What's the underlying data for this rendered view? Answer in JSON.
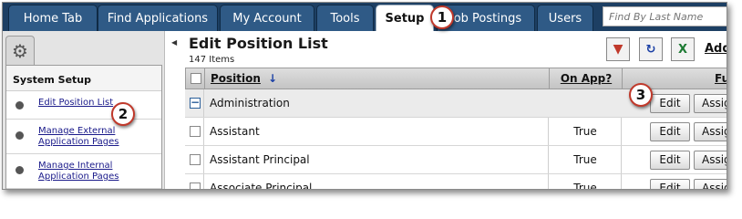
{
  "nav": {
    "tabs": [
      {
        "label": "Home Tab"
      },
      {
        "label": "Find Applications"
      },
      {
        "label": "My Account"
      },
      {
        "label": "Tools"
      },
      {
        "label": "Setup",
        "active": true
      },
      {
        "label": "Job Postings"
      },
      {
        "label": "Users"
      }
    ],
    "search_placeholder": "Find By Last Name"
  },
  "sidebar": {
    "title": "System Setup",
    "items": [
      {
        "label": "Edit Position List"
      },
      {
        "label": "Manage External Application Pages"
      },
      {
        "label": "Manage Internal Application Pages"
      }
    ],
    "icon": "gear-icon"
  },
  "main": {
    "title": "Edit Position List",
    "item_count": "147 Items",
    "add_label": "Add",
    "toolbar_icons": [
      "clear-filter-icon",
      "refresh-icon",
      "excel-export-icon"
    ]
  },
  "grid": {
    "columns": {
      "position": "Position",
      "on_app": "On App?",
      "functions": "Functions"
    },
    "group": {
      "label": "Administration",
      "expander": "−"
    },
    "rows": [
      {
        "position": "Assistant",
        "on_app": "True"
      },
      {
        "position": "Assistant Principal",
        "on_app": "True"
      },
      {
        "position": "Associate Principal",
        "on_app": "True"
      }
    ],
    "edit_label": "Edit",
    "assign_label": "Assign"
  },
  "callouts": [
    "1",
    "2",
    "3"
  ],
  "colors": {
    "nav_bg": "#1d3f63",
    "tab_bg": "#2f5a86",
    "callout_border": "#c0392b",
    "link": "#1a1a8a"
  }
}
